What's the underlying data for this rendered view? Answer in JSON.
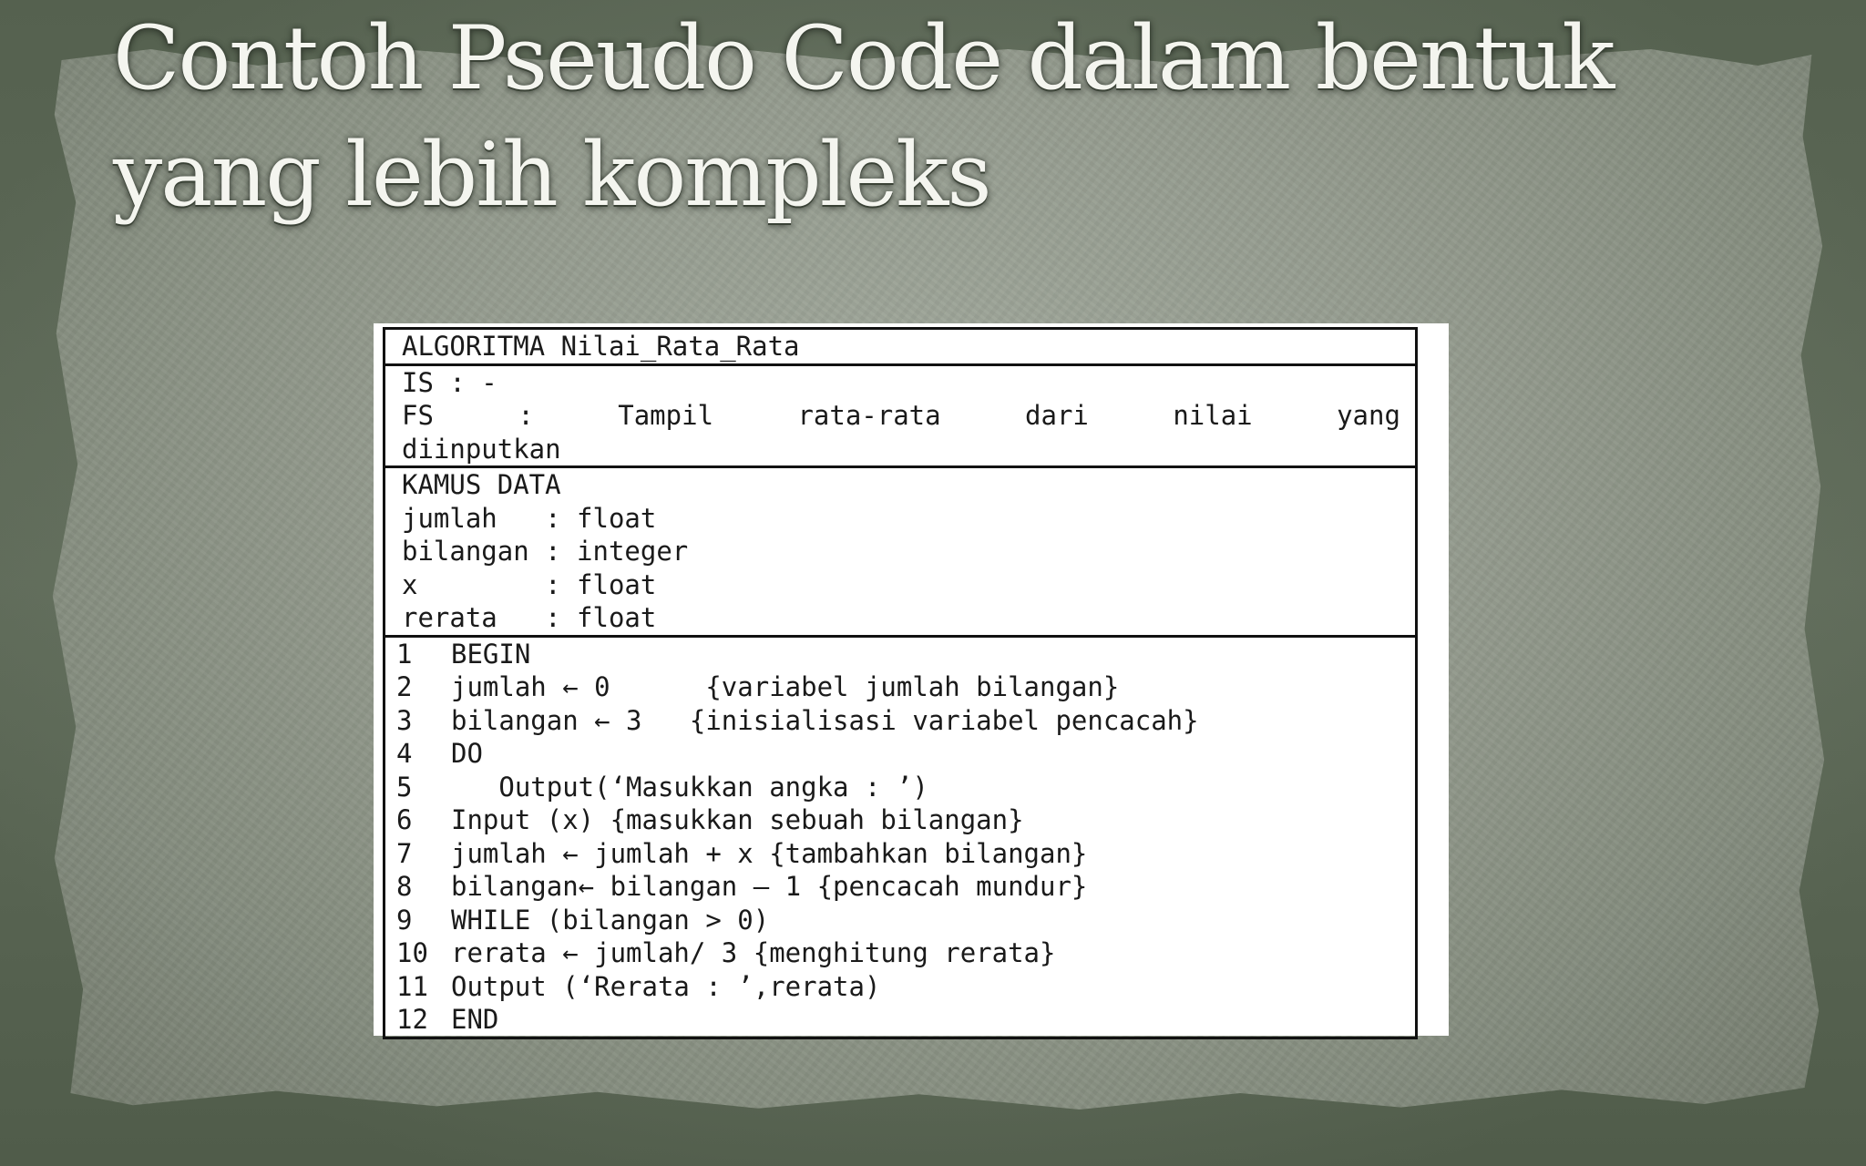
{
  "slide": {
    "title": "Contoh Pseudo Code dalam bentuk yang lebih kompleks"
  },
  "algorithm": {
    "header": "ALGORITMA Nilai_Rata_Rata",
    "is_line": "IS : -",
    "fs_words": [
      "FS",
      ":",
      "Tampil",
      "rata-rata",
      "dari",
      "nilai",
      "yang"
    ],
    "fs_continuation": "diinputkan",
    "kamus_title": "KAMUS DATA",
    "kamus": [
      "jumlah   : float",
      "bilangan : integer",
      "x        : float",
      "rerata   : float"
    ],
    "steps": [
      {
        "no": "1",
        "code": "BEGIN"
      },
      {
        "no": "2",
        "code": "jumlah ← 0      {variabel jumlah bilangan}"
      },
      {
        "no": "3",
        "code": "bilangan ← 3   {inisialisasi variabel pencacah}"
      },
      {
        "no": "4",
        "code": "DO"
      },
      {
        "no": "5",
        "code": "   Output(‘Masukkan angka : ’)"
      },
      {
        "no": "6",
        "code": "Input (x) {masukkan sebuah bilangan}"
      },
      {
        "no": "7",
        "code": "jumlah ← jumlah + x {tambahkan bilangan}"
      },
      {
        "no": "8",
        "code": "bilangan← bilangan – 1 {pencacah mundur}"
      },
      {
        "no": "9",
        "code": "WHILE (bilangan > 0)"
      },
      {
        "no": "10",
        "code": "rerata ← jumlah/ 3 {menghitung rerata}"
      },
      {
        "no": "11",
        "code": "Output (‘Rerata : ’,rerata)"
      },
      {
        "no": "12",
        "code": "END"
      }
    ]
  }
}
